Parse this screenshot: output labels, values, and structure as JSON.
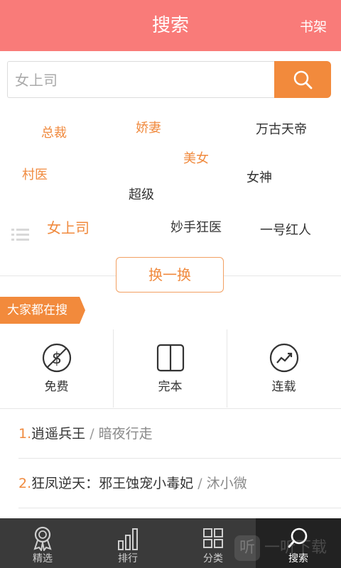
{
  "header": {
    "title": "搜索",
    "bookshelf": "书架"
  },
  "search": {
    "value": "",
    "placeholder": "女上司",
    "button_icon": "search-icon"
  },
  "hot_tags": [
    {
      "label": "总裁",
      "color": "#f08a3e"
    },
    {
      "label": "娇妻",
      "color": "#f08a3e"
    },
    {
      "label": "万古天帝",
      "color": "#333333"
    },
    {
      "label": "美女",
      "color": "#f08a3e"
    },
    {
      "label": "村医",
      "color": "#f08a3e"
    },
    {
      "label": "女神",
      "color": "#333333"
    },
    {
      "label": "超级",
      "color": "#333333"
    },
    {
      "label": "女上司",
      "color": "#f08a3e"
    },
    {
      "label": "妙手狂医",
      "color": "#333333"
    },
    {
      "label": "一号红人",
      "color": "#333333"
    }
  ],
  "swap_label": "换一换",
  "section_title": "大家都在搜",
  "categories": [
    {
      "label": "免费",
      "icon": "dollar-icon"
    },
    {
      "label": "完本",
      "icon": "book-icon"
    },
    {
      "label": "连载",
      "icon": "trend-icon"
    }
  ],
  "rankings": [
    {
      "num": "1.",
      "title": "逍遥兵王",
      "sep": " / ",
      "author": "暗夜行走"
    },
    {
      "num": "2.",
      "title": "狂凤逆天：邪王蚀宠小毒妃",
      "sep": " / ",
      "author": "沐小微"
    }
  ],
  "tabs": [
    {
      "label": "精选",
      "icon": "ribbon-icon",
      "active": false
    },
    {
      "label": "排行",
      "icon": "bar-chart-icon",
      "active": false
    },
    {
      "label": "分类",
      "icon": "grid-icon",
      "active": false
    },
    {
      "label": "搜索",
      "icon": "search-icon",
      "active": true
    }
  ],
  "watermark": {
    "badge": "听",
    "text": "一听下载"
  },
  "colors": {
    "header": "#f97b79",
    "accent": "#f28a3c",
    "tabbar": "#3a3a3a"
  }
}
